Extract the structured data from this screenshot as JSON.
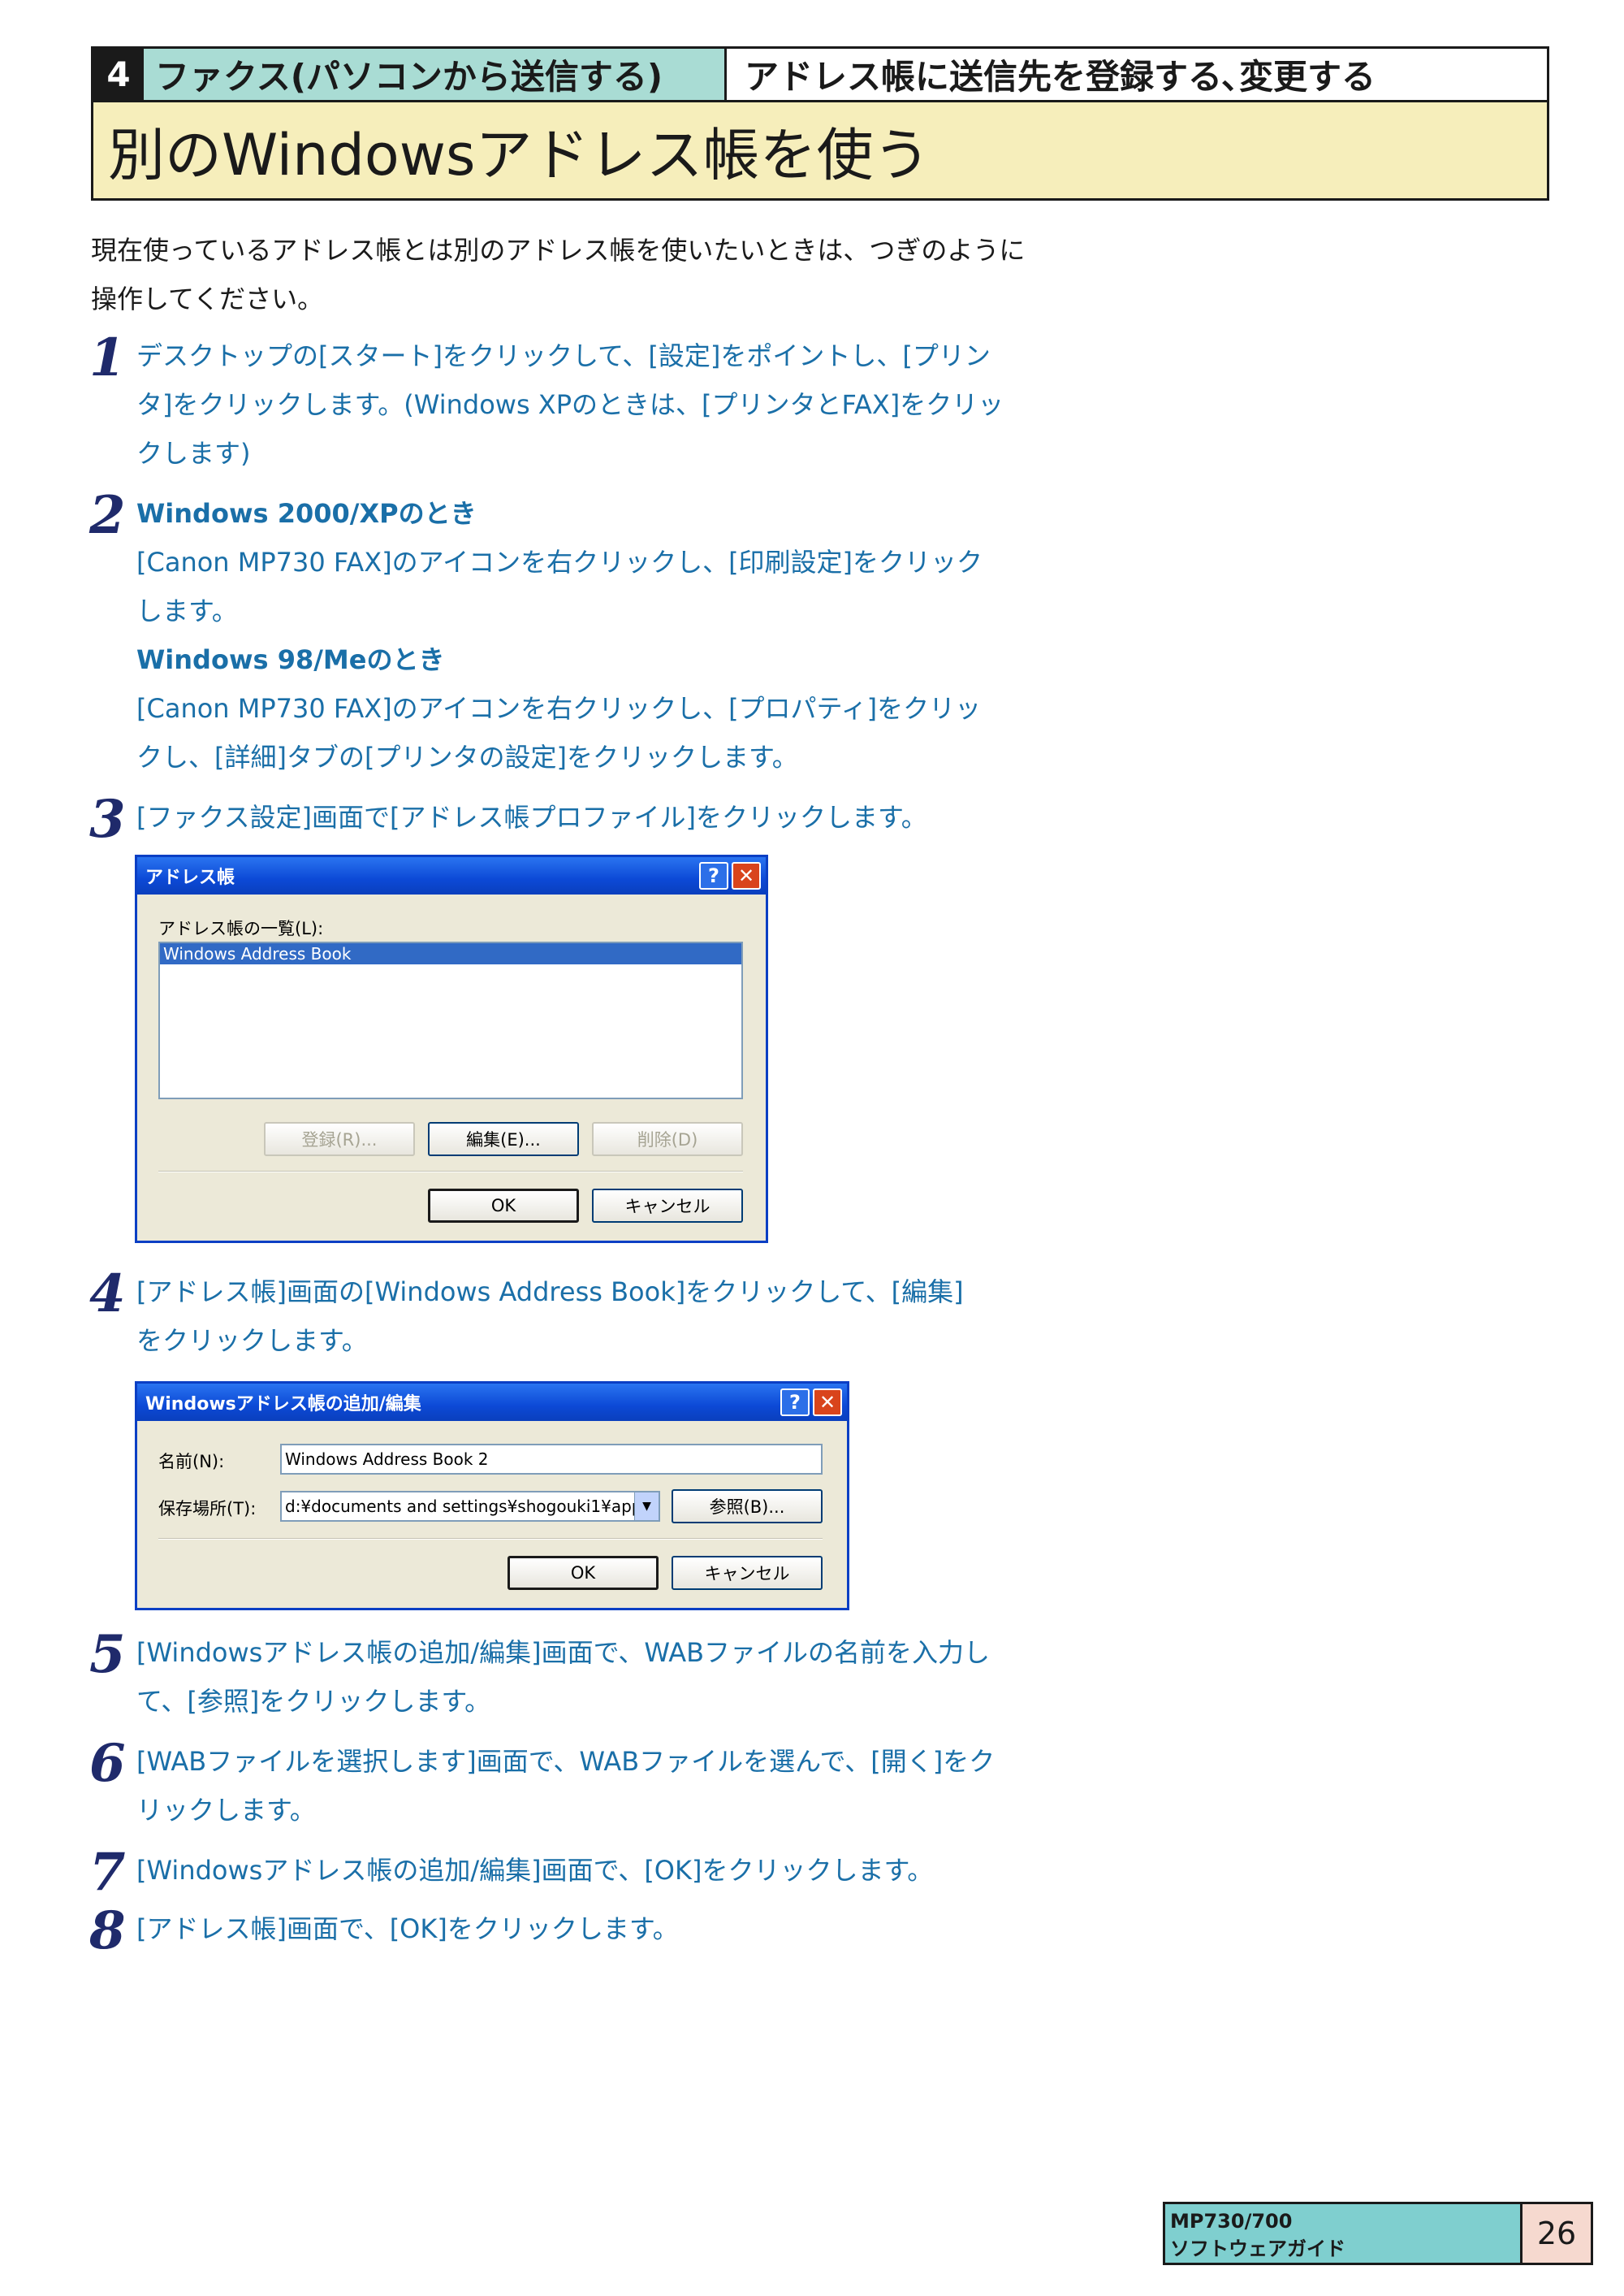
{
  "header": {
    "chapter_number": "4",
    "chapter_title": "ファクス(パソコンから送信する)",
    "section_title": "アドレス帳に送信先を登録する､変更する",
    "page_title": "別のWindowsアドレス帳を使う"
  },
  "intro": [
    "現在使っているアドレス帳とは別のアドレス帳を使いたいときは、つぎのように",
    "操作してください。"
  ],
  "steps": [
    {
      "number": "1",
      "lines": [
        "デスクトップの[スタート]をクリックして、[設定]をポイントし、[プリン",
        "タ]をクリックします。(Windows XPのときは、[プリンタとFAX]をクリッ",
        "クします)"
      ]
    },
    {
      "number": "2",
      "sub1": "Windows 2000/XPのとき",
      "lines1": [
        "[Canon MP730 FAX]のアイコンを右クリックし、[印刷設定]をクリック",
        "します。"
      ],
      "sub2": "Windows 98/Meのとき",
      "lines2": [
        "[Canon MP730 FAX]のアイコンを右クリックし、[プロパティ]をクリッ",
        "クし、[詳細]タブの[プリンタの設定]をクリックします。"
      ]
    },
    {
      "number": "3",
      "lines": [
        "[ファクス設定]画面で[アドレス帳プロファイル]をクリックします。"
      ]
    },
    {
      "number": "4",
      "lines": [
        "[アドレス帳]画面の[Windows Address Book]をクリックして、[編集]",
        "をクリックします。"
      ]
    },
    {
      "number": "5",
      "lines": [
        "[Windowsアドレス帳の追加/編集]画面で、WABファイルの名前を入力し",
        "て、[参照]をクリックします。"
      ]
    },
    {
      "number": "6",
      "lines": [
        "[WABファイルを選択します]画面で、WABファイルを選んで、[開く]をク",
        "リックします。"
      ]
    },
    {
      "number": "7",
      "lines": [
        "[Windowsアドレス帳の追加/編集]画面で、[OK]をクリックします。"
      ]
    },
    {
      "number": "8",
      "lines": [
        "[アドレス帳]画面で、[OK]をクリックします。"
      ]
    }
  ],
  "dialog1": {
    "title": "アドレス帳",
    "help_btn": "?",
    "close_btn": "✕",
    "list_label": "アドレス帳の一覧(L):",
    "list_items": [
      "Windows Address Book"
    ],
    "register_btn": "登録(R)...",
    "edit_btn": "編集(E)...",
    "delete_btn": "削除(D)",
    "ok_btn": "OK",
    "cancel_btn": "キャンセル"
  },
  "dialog2": {
    "title": "Windowsアドレス帳の追加/編集",
    "help_btn": "?",
    "close_btn": "✕",
    "name_label": "名前(N):",
    "name_value": "Windows Address Book 2",
    "location_label": "保存場所(T):",
    "location_value": "d:¥documents and settings¥shogouki1¥appl",
    "browse_btn": "参照(B)...",
    "ok_btn": "OK",
    "cancel_btn": "キャンセル"
  },
  "footer": {
    "model": "MP730/700",
    "guide": "ソフトウェアガイド",
    "page": "26"
  },
  "colors": {
    "chapter_bg": "#a9dcd4",
    "title_bg": "#f6eebb",
    "step_text": "#1a6fa8",
    "step_number": "#1f2a6b",
    "footer_bg": "#7fcfcf",
    "page_bg": "#f6d9cf"
  }
}
